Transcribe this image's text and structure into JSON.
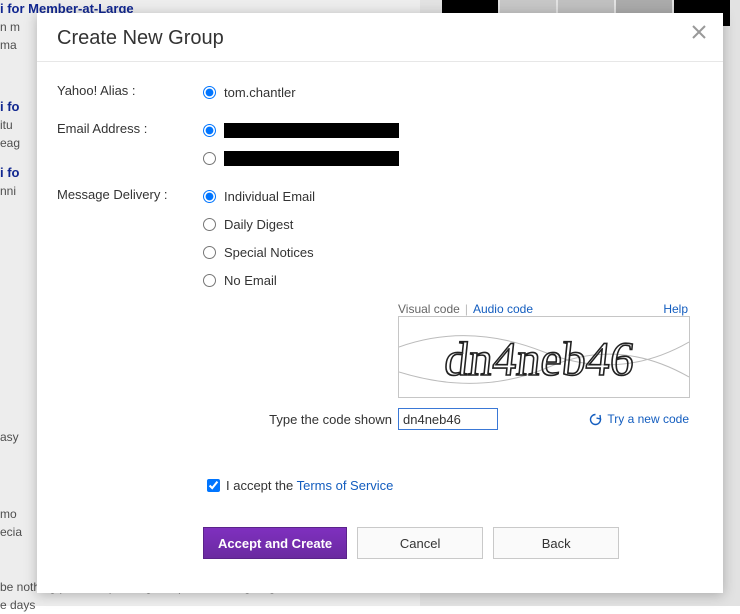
{
  "bg": {
    "link1": "i for Member-at-Large",
    "link2": "i fo",
    "link3": "i fo",
    "frag1": "n m",
    "frag2": "ma",
    "frag3": "itu",
    "frag4": "eag",
    "frag5": "nni",
    "frag6": "asy",
    "frag7": "mo",
    "frag8": "ecia",
    "frag9": "be nothing prevents proofing companies from giving a candidate",
    "frag10": "e days"
  },
  "modal": {
    "title": "Create New Group",
    "alias_label": "Yahoo! Alias :",
    "alias_value": "tom.chantler",
    "email_label": "Email Address :",
    "delivery_label": "Message Delivery :",
    "delivery": {
      "individual": "Individual Email",
      "daily": "Daily Digest",
      "special": "Special Notices",
      "none": "No Email"
    },
    "captcha": {
      "visual_tab": "Visual code",
      "audio_tab": "Audio code",
      "help": "Help",
      "prompt": "Type the code shown",
      "value": "dn4neb46",
      "try_new": "Try a new code"
    },
    "tos": {
      "prefix": "I accept the ",
      "link": "Terms of Service"
    },
    "buttons": {
      "accept": "Accept and Create",
      "cancel": "Cancel",
      "back": "Back"
    }
  }
}
